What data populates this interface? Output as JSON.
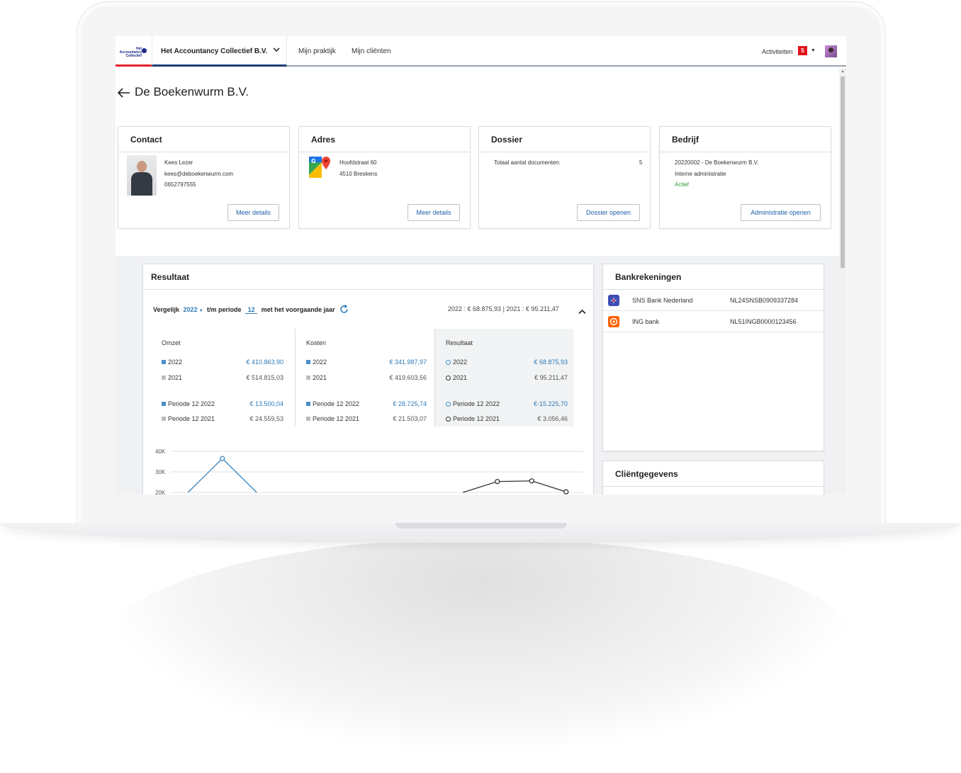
{
  "nav": {
    "logo_text": "Het Accountancy Collectief",
    "org_name": "Het Accountancy Collectief B.V.",
    "links": [
      "Mijn praktijk",
      "Mijn cliënten"
    ],
    "activities_label": "Activiteiten",
    "activities_count": "5"
  },
  "page": {
    "title": "De Boekenwurm B.V."
  },
  "contact": {
    "title": "Contact",
    "name": "Kees Lezer",
    "email": "kees@deboekenwurm.com",
    "phone": "0652797555",
    "button": "Meer details"
  },
  "address": {
    "title": "Adres",
    "street": "Hoofdstraat 60",
    "city": "4510 Breskens",
    "button": "Meer details"
  },
  "dossier": {
    "title": "Dossier",
    "docs_label": "Totaal aantal documenten:",
    "docs_count": "5",
    "button": "Dossier openen"
  },
  "company": {
    "title": "Bedrijf",
    "line1": "20220002 - De Boekenwurm B.V.",
    "line2": "Interne administratie",
    "status": "Actief",
    "button": "Administratie openen",
    "status_color": "#2e9a3d"
  },
  "result": {
    "title": "Resultaat",
    "compare_label": "Vergelijk",
    "year": "2022",
    "period_label": "t/m periode",
    "period": "12",
    "suffix": "met het voorgaande jaar",
    "summary": "2022 : € 68.875,93 | 2021 : € 95.211,47",
    "columns": [
      {
        "header": "Omzet",
        "rows": [
          {
            "label": "2022",
            "value": "€ 410.863,90"
          },
          {
            "label": "2021",
            "value": "€ 514.815,03"
          },
          {
            "label": "Periode 12 2022",
            "value": "€ 13.500,04"
          },
          {
            "label": "Periode 12 2021",
            "value": "€ 24.559,53"
          }
        ]
      },
      {
        "header": "Kosten",
        "rows": [
          {
            "label": "2022",
            "value": "€ 341.987,97"
          },
          {
            "label": "2021",
            "value": "€ 419.603,56"
          },
          {
            "label": "Periode 12 2022",
            "value": "€ 28.725,74"
          },
          {
            "label": "Periode 12 2021",
            "value": "€ 21.503,07"
          }
        ]
      },
      {
        "header": "Resultaat",
        "rows": [
          {
            "label": "2022",
            "value": "€ 68.875,93"
          },
          {
            "label": "2021",
            "value": "€ 95.211,47"
          },
          {
            "label": "Periode 12 2022",
            "value": "€-15.225,70"
          },
          {
            "label": "Periode 12 2021",
            "value": "€ 3.056,46"
          }
        ]
      }
    ],
    "colors": {
      "current": "#4a90c9",
      "previous": "#bdbdbd",
      "ring_current": "#4a90c9",
      "ring_previous": "#333333"
    }
  },
  "chart_data": {
    "type": "line",
    "ylim": [
      20000,
      40000
    ],
    "yticks": [
      "40K",
      "30K",
      "20K"
    ],
    "series": [
      {
        "points": [
          [
            1,
            20000
          ],
          [
            2,
            36500
          ],
          [
            3,
            20000
          ]
        ]
      },
      {
        "points": [
          [
            9,
            20000
          ],
          [
            10,
            25300
          ],
          [
            11,
            25600
          ],
          [
            12,
            20300
          ]
        ]
      }
    ]
  },
  "banks": {
    "title": "Bankrekeningen",
    "rows": [
      {
        "name": "SNS Bank Nederland",
        "iban": "NL24SNSB0909337284",
        "icon": "sns-bank-icon",
        "color": "#3d4fb5"
      },
      {
        "name": "ING bank",
        "iban": "NL51INGB0000123456",
        "icon": "ing-bank-icon",
        "color": "#ff6200"
      }
    ]
  },
  "client": {
    "title": "Cliëntgegevens"
  }
}
